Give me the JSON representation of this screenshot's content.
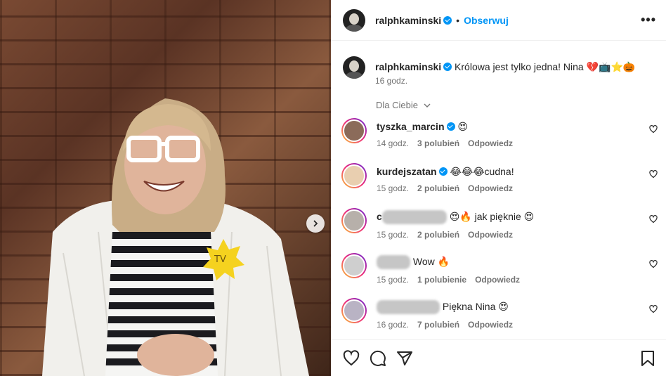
{
  "photo": {
    "badge_text": "TV"
  },
  "post": {
    "username": "ralphkaminski",
    "follow_label": "Obserwuj",
    "separator": "•",
    "more_label": "•••",
    "caption_text": "Królowa jest tylko jedna! Nina 💔📺⭐🎃",
    "caption_time": "16 godz."
  },
  "filter_label": "Dla Ciebie",
  "comments": [
    {
      "username": "tyszka_marcin",
      "verified": true,
      "text": "😍",
      "time": "14 godz.",
      "likes": "3 polubień",
      "reply": "Odpowiedz"
    },
    {
      "username": "kurdejszatan",
      "verified": true,
      "text": "😂😂😂cudna!",
      "time": "15 godz.",
      "likes": "2 polubień",
      "reply": "Odpowiedz"
    },
    {
      "username": "c",
      "verified": false,
      "text": "😍🔥 jak pięknie 😍",
      "time": "15 godz.",
      "likes": "2 polubień",
      "reply": "Odpowiedz"
    },
    {
      "username": "",
      "verified": false,
      "text": "Wow 🔥",
      "time": "15 godz.",
      "likes": "1 polubienie",
      "reply": "Odpowiedz"
    },
    {
      "username": "",
      "verified": false,
      "text": "Piękna Nina 😍",
      "time": "16 godz.",
      "likes": "7 polubień",
      "reply": "Odpowiedz"
    }
  ],
  "icons": {
    "like": "heart-icon",
    "comment": "comment-icon",
    "share": "send-icon",
    "save": "bookmark-icon",
    "next": "chevron-right-icon",
    "verified": "verified-badge-icon"
  },
  "colors": {
    "accent": "#0095f6",
    "muted": "#737373",
    "text": "#262626"
  }
}
